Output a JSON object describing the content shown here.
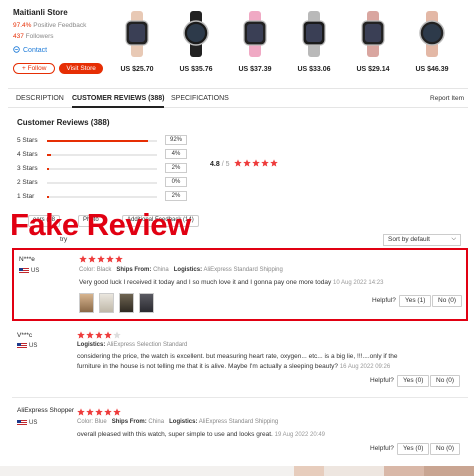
{
  "store": {
    "name": "Maitianli Store",
    "feedback_value": "97.4%",
    "feedback_label": "Positive Feedback",
    "followers_value": "437",
    "followers_label": "Followers",
    "contact": "Contact",
    "follow_btn": "+ Follow",
    "visit_btn": "Visit Store"
  },
  "products": [
    {
      "price": "US $25.70",
      "band": "#e8c9b5",
      "face": "#222"
    },
    {
      "price": "US $35.76",
      "band": "#222222",
      "face": "#1a1a1a"
    },
    {
      "price": "US $37.39",
      "band": "#f0a9c4",
      "face": "#222"
    },
    {
      "price": "US $33.06",
      "band": "#b9b9b9",
      "face": "#1a1a1a"
    },
    {
      "price": "US $29.14",
      "band": "#d9a6a0",
      "face": "#222"
    },
    {
      "price": "US $46.39",
      "band": "#e3b8a6",
      "face": "#222"
    }
  ],
  "tabs": {
    "description": "DESCRIPTION",
    "reviews": "CUSTOMER REVIEWS (388)",
    "specs": "SPECIFICATIONS",
    "report": "Report Item"
  },
  "summary": {
    "title": "Customer Reviews (388)",
    "rows": [
      {
        "label": "5 Stars",
        "pct": "92%",
        "fraction": 0.92
      },
      {
        "label": "4 Stars",
        "pct": "4%",
        "fraction": 0.04
      },
      {
        "label": "3 Stars",
        "pct": "2%",
        "fraction": 0.02
      },
      {
        "label": "2 Stars",
        "pct": "0%",
        "fraction": 0.0
      },
      {
        "label": "1 Star",
        "pct": "2%",
        "fraction": 0.02
      }
    ],
    "average": "4.8",
    "out_of": "/ 5",
    "stars": 5
  },
  "filters": {
    "chip1": "ears (38",
    "chip2": "Photo",
    "chip3": "Additional Feedback (14)",
    "row2": "try",
    "sort": "Sort by default"
  },
  "overlay_title": "Fake Review",
  "colors": {
    "accent": "#e62e04",
    "star": "#ee3b3b",
    "highlight_border": "#e10012"
  },
  "reviews": [
    {
      "user": "N***e",
      "country": "US",
      "stars": 5,
      "color_label": "Color:",
      "color": "Black",
      "ships_label": "Ships From:",
      "ships": "China",
      "logistics_label": "Logistics:",
      "logistics": "AliExpress Standard Shipping",
      "text": "Very good luck I received it today and I so much love it and I gonna pay one more today",
      "date": "10 Aug 2022 14:23",
      "helpful": "Helpful?",
      "yes": "Yes (1)",
      "no": "No (0)"
    },
    {
      "user": "V***c",
      "country": "US",
      "stars": 4,
      "logistics_label": "Logistics:",
      "logistics": "AliExpress Selection Standard",
      "text": "considering the price, the watch is excellent. but measuring heart rate, oxygen... etc... is a big lie, !!!....only if the",
      "text2": "furniture in the house is not telling me that it is alive. Maybe I'm actually a sleeping beauty?",
      "date": "16 Aug 2022 09:26",
      "helpful": "Helpful?",
      "yes": "Yes (0)",
      "no": "No (0)"
    },
    {
      "user": "AliExpress Shopper",
      "country": "US",
      "stars": 5,
      "color_label": "Color:",
      "color": "Blue",
      "ships_label": "Ships From:",
      "ships": "China",
      "logistics_label": "Logistics:",
      "logistics": "AliExpress Standard Shipping",
      "text": "overall pleased with this watch, super simple to use and looks great.",
      "date": "19 Aug 2022 20:49",
      "helpful": "Helpful?",
      "yes": "Yes (0)",
      "no": "No (0)"
    }
  ]
}
